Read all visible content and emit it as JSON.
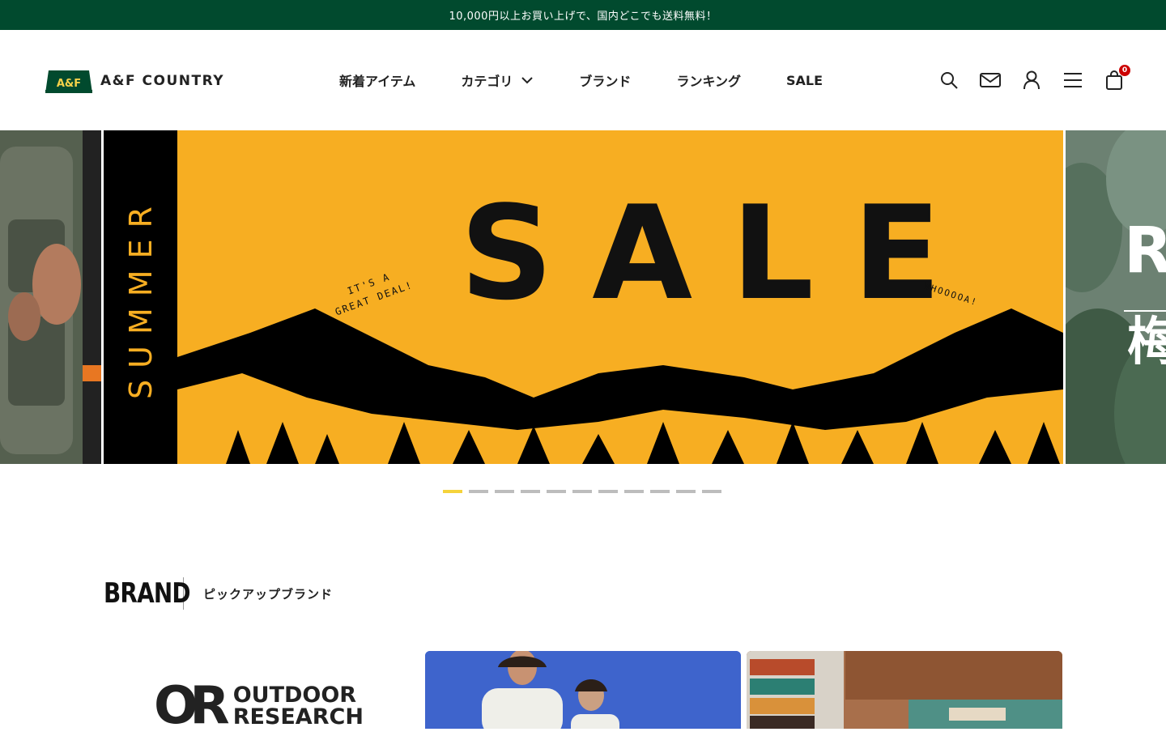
{
  "topbar": {
    "message": "10,000円以上お買い上げで、国内どこでも送料無料！"
  },
  "header": {
    "logo_mark": "A&F",
    "logo_text": "A&F COUNTRY",
    "nav": [
      {
        "label": "新着アイテム"
      },
      {
        "label": "カテゴリ",
        "has_dropdown": true
      },
      {
        "label": "ブランド"
      },
      {
        "label": "ランキング"
      },
      {
        "label": "SALE"
      }
    ],
    "icons": [
      "search-icon",
      "mail-icon",
      "user-icon",
      "menu-icon",
      "cart-icon"
    ],
    "cart_count": "0",
    "colors": {
      "brand_green": "#014a2e",
      "cart_badge": "#cc0000"
    }
  },
  "hero": {
    "main_slide": {
      "side_text": "SUMMER",
      "title": "SALE",
      "hand_left": "IT'S A GREAT DEAL!",
      "hand_right": "WHOOOOA!",
      "background": "#f7ae22"
    },
    "right_slide": {
      "title_partial": "RA",
      "kanji_partial": "梅"
    },
    "dots": {
      "count": 11,
      "active_index": 0
    }
  },
  "brand_section": {
    "title": "BRAND",
    "subtitle": "ピックアップブランド",
    "items": [
      {
        "logo_mark": "OR",
        "logo_line1": "OUTDOOR",
        "logo_line2": "RESEARCH"
      },
      {
        "image": "people-tshirts-photo"
      },
      {
        "image": "blankets-rug-photo"
      }
    ]
  }
}
